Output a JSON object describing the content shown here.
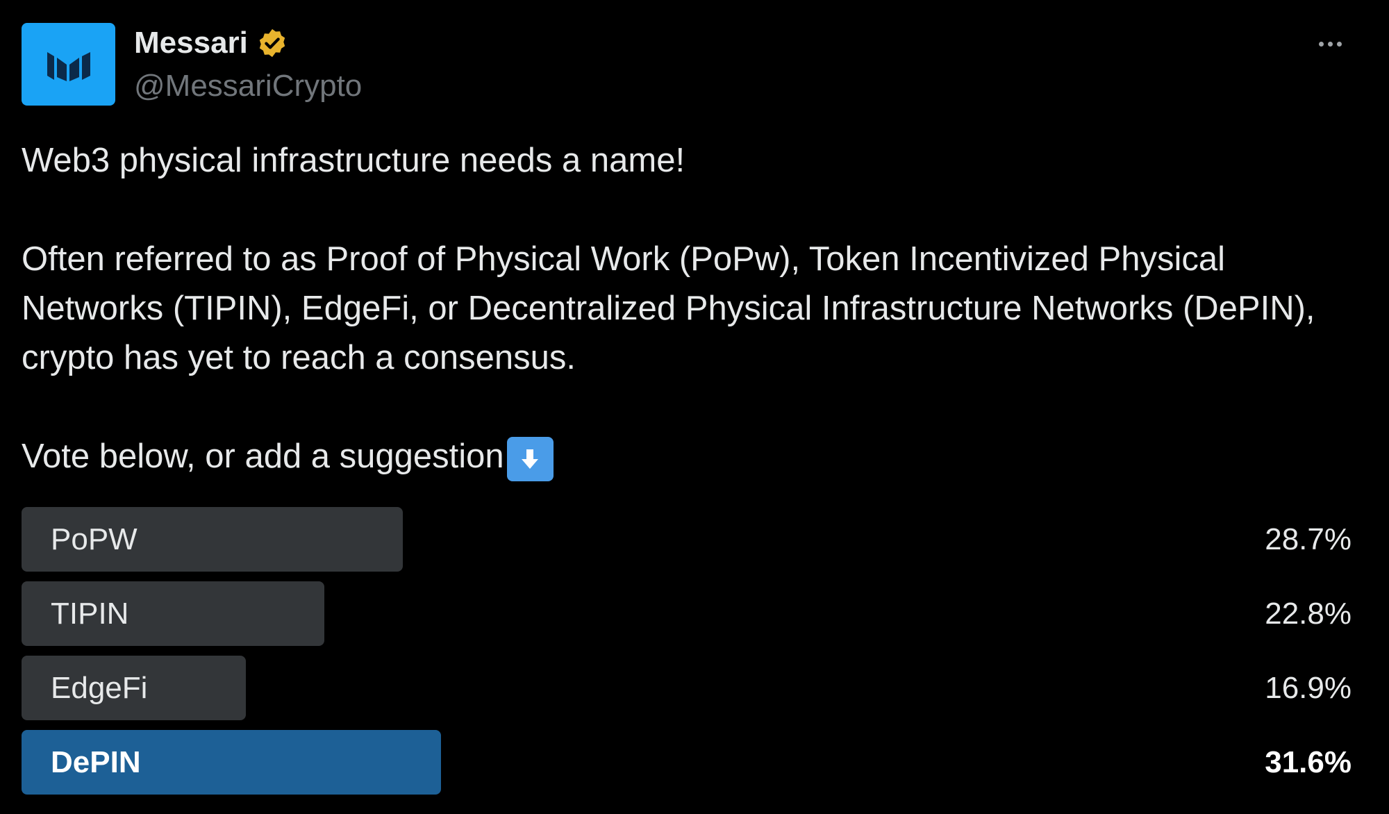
{
  "author": {
    "display_name": "Messari",
    "handle": "@MessariCrypto",
    "verified": true,
    "avatar_icon": "messari-logo-icon",
    "avatar_color": "#1aa3f5",
    "verified_color": "#e8b32d"
  },
  "tweet": {
    "paragraphs": [
      "Web3 physical infrastructure needs a name!",
      "Often referred to as Proof of Physical Work (PoPw), Token Incentivized Physical Networks (TIPIN), EdgeFi, or Decentralized Physical Infrastructure Networks (DePIN), crypto has yet to reach a consensus.",
      "Vote below, or add a suggestion"
    ],
    "trailing_emoji": "down-arrow-emoji-icon"
  },
  "poll": {
    "options": [
      {
        "label": "PoPW",
        "percent_text": "28.7%",
        "percent": 28.7,
        "winner": false
      },
      {
        "label": "TIPIN",
        "percent_text": "22.8%",
        "percent": 22.8,
        "winner": false
      },
      {
        "label": "EdgeFi",
        "percent_text": "16.9%",
        "percent": 16.9,
        "winner": false
      },
      {
        "label": "DePIN",
        "percent_text": "31.6%",
        "percent": 31.6,
        "winner": true
      }
    ],
    "bar_color": "#333639",
    "winner_bar_color": "#1d6096"
  },
  "menu": {
    "icon": "more-horizontal-icon"
  }
}
